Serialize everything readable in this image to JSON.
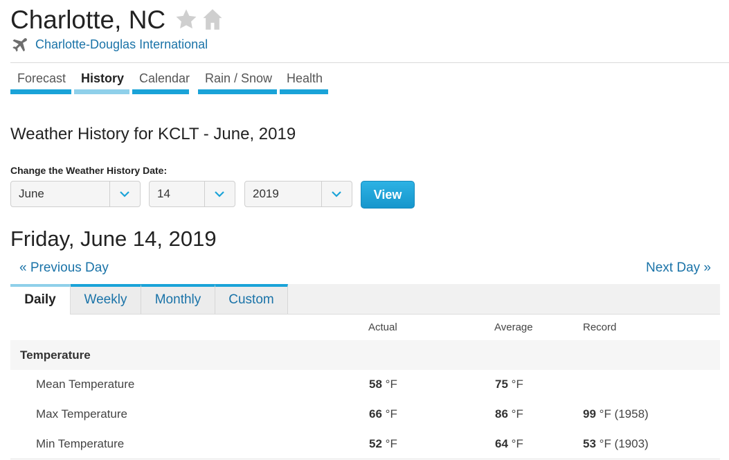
{
  "header": {
    "city": "Charlotte, NC",
    "station": "Charlotte-Douglas International"
  },
  "nav_tabs": [
    {
      "label": "Forecast",
      "active": false
    },
    {
      "label": "History",
      "active": true
    },
    {
      "label": "Calendar",
      "active": false
    },
    {
      "label": "Rain / Snow",
      "active": false
    },
    {
      "label": "Health",
      "active": false
    }
  ],
  "history": {
    "title": "Weather History for KCLT - June, 2019",
    "change_label": "Change the Weather History Date:",
    "month": "June",
    "day": "14",
    "year": "2019",
    "view_label": "View"
  },
  "day": {
    "title": "Friday, June 14, 2019",
    "prev": "« Previous Day",
    "next": "Next Day »"
  },
  "period_tabs": [
    {
      "label": "Daily",
      "active": true
    },
    {
      "label": "Weekly",
      "active": false
    },
    {
      "label": "Monthly",
      "active": false
    },
    {
      "label": "Custom",
      "active": false
    }
  ],
  "table": {
    "columns": [
      "Actual",
      "Average",
      "Record"
    ],
    "section": "Temperature",
    "rows": [
      {
        "label": "Mean Temperature",
        "actual": "58",
        "actual_unit": "°F",
        "average": "75",
        "average_unit": "°F",
        "record": "",
        "record_unit": ""
      },
      {
        "label": "Max Temperature",
        "actual": "66",
        "actual_unit": "°F",
        "average": "86",
        "average_unit": "°F",
        "record": "99",
        "record_unit": "°F (1958)"
      },
      {
        "label": "Min Temperature",
        "actual": "52",
        "actual_unit": "°F",
        "average": "64",
        "average_unit": "°F",
        "record": "53",
        "record_unit": "°F (1903)"
      }
    ]
  },
  "colors": {
    "accent": "#1aa3d8",
    "link": "#1a73a8",
    "active_tab_bar": "#8fd0ea"
  }
}
